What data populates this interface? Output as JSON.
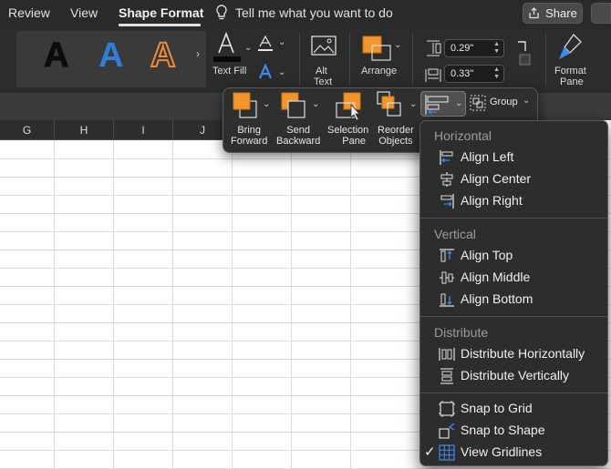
{
  "tabs": {
    "review": "Review",
    "view": "View",
    "shape_format": "Shape Format",
    "tell_me": "Tell me what you want to do"
  },
  "share": {
    "label": "Share"
  },
  "ribbon": {
    "wordart_letter": "A",
    "text_fill": "Text Fill",
    "alt_text_1": "Alt",
    "alt_text_2": "Text",
    "arrange": "Arrange",
    "height": "0.29\"",
    "width": "0.33\"",
    "format_pane_1": "Format",
    "format_pane_2": "Pane"
  },
  "columns": [
    "G",
    "H",
    "I",
    "J"
  ],
  "arrange_popup": {
    "bring_forward": [
      "Bring",
      "Forward"
    ],
    "send_backward": [
      "Send",
      "Backward"
    ],
    "selection_pane": [
      "Selection",
      "Pane"
    ],
    "reorder_objects": [
      "Reorder",
      "Objects"
    ],
    "group": "Group"
  },
  "align_menu": {
    "horizontal": "Horizontal",
    "align_left": "Align Left",
    "align_center": "Align Center",
    "align_right": "Align Right",
    "vertical": "Vertical",
    "align_top": "Align Top",
    "align_middle": "Align Middle",
    "align_bottom": "Align Bottom",
    "distribute": "Distribute",
    "distribute_h": "Distribute Horizontally",
    "distribute_v": "Distribute Vertically",
    "snap_grid": "Snap to Grid",
    "snap_shape": "Snap to Shape",
    "view_gridlines": "View Gridlines",
    "view_gridlines_checked": true
  },
  "colors": {
    "accent_orange": "#f0962a",
    "accent_blue": "#2f7fd6",
    "menu_bg": "#2d2d2d"
  }
}
